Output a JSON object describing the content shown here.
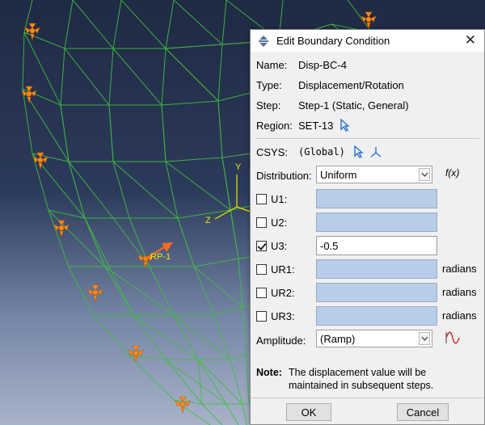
{
  "viewport": {
    "rp_label": "RP-1",
    "triad": {
      "y": "Y",
      "z": "Z"
    }
  },
  "dialog": {
    "title": "Edit Boundary Condition",
    "close_glyph": "✕",
    "name": {
      "label": "Name:",
      "value": "Disp-BC-4"
    },
    "type": {
      "label": "Type:",
      "value": "Displacement/Rotation"
    },
    "step": {
      "label": "Step:",
      "value": "Step-1 (Static, General)"
    },
    "region": {
      "label": "Region:",
      "value": "SET-13"
    },
    "csys": {
      "label": "CSYS:",
      "value": "(Global)"
    },
    "distribution": {
      "label": "Distribution:",
      "value": "Uniform",
      "fx": "f(x)"
    },
    "dofs": [
      {
        "label": "U1:",
        "checked": false,
        "value": "",
        "unit": ""
      },
      {
        "label": "U2:",
        "checked": false,
        "value": "",
        "unit": ""
      },
      {
        "label": "U3:",
        "checked": true,
        "value": "-0.5",
        "unit": ""
      },
      {
        "label": "UR1:",
        "checked": false,
        "value": "",
        "unit": "radians"
      },
      {
        "label": "UR2:",
        "checked": false,
        "value": "",
        "unit": "radians"
      },
      {
        "label": "UR3:",
        "checked": false,
        "value": "",
        "unit": "radians"
      }
    ],
    "amplitude": {
      "label": "Amplitude:",
      "value": "(Ramp)"
    },
    "note": {
      "label": "Note:",
      "line1": "The displacement value will be",
      "line2": "maintained in subsequent steps."
    },
    "ok_label": "OK",
    "cancel_label": "Cancel"
  },
  "colors": {
    "mesh": "#3fbf3f",
    "marker": "#ff8c1a",
    "triad": "#f2e600",
    "field_inactive": "#b9cdea"
  }
}
